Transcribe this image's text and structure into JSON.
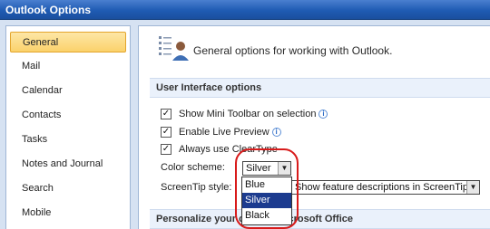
{
  "window": {
    "title": "Outlook Options"
  },
  "nav": {
    "items": [
      {
        "label": "General",
        "selected": true
      },
      {
        "label": "Mail"
      },
      {
        "label": "Calendar"
      },
      {
        "label": "Contacts"
      },
      {
        "label": "Tasks"
      },
      {
        "label": "Notes and Journal"
      },
      {
        "label": "Search"
      },
      {
        "label": "Mobile"
      }
    ]
  },
  "main": {
    "header": "General options for working with Outlook.",
    "ui_section_title": "User Interface options",
    "options": {
      "mini_toolbar": {
        "label": "Show Mini Toolbar on selection",
        "checked": true
      },
      "live_preview": {
        "label": "Enable Live Preview",
        "checked": true
      },
      "cleartype": {
        "label": "Always use ClearType",
        "checked": true
      }
    },
    "color_scheme": {
      "label": "Color scheme:",
      "value": "Silver",
      "options": [
        "Blue",
        "Silver",
        "Black"
      ]
    },
    "screentip": {
      "label": "ScreenTip style:",
      "value": "Show feature descriptions in ScreenTips"
    },
    "personalize_section_title": "Personalize your copy of Microsoft Office"
  },
  "icons": {
    "checkmark": "✓",
    "dropdown_arrow": "▼",
    "info": "i"
  },
  "colors": {
    "highlight_ring": "#d81b1b",
    "selected_option_bg": "#1c3b8f",
    "nav_selected_bg": "#fbd26b"
  }
}
